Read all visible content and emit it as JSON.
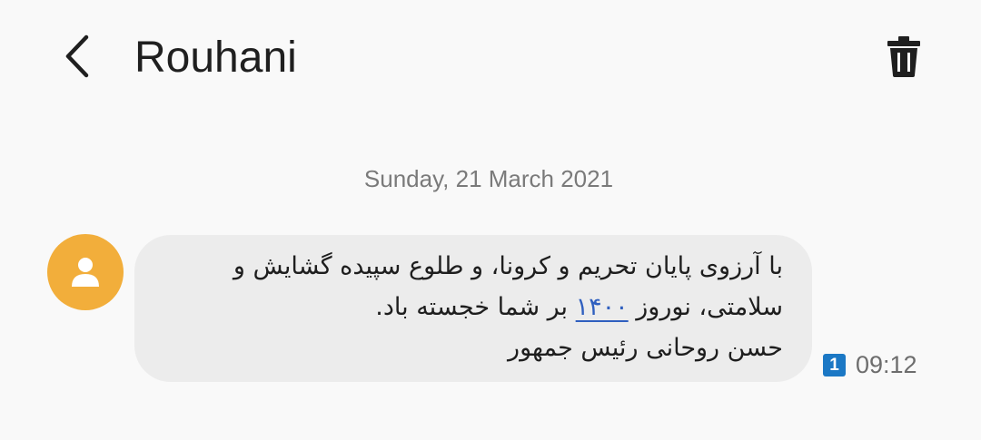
{
  "header": {
    "title": "Rouhani",
    "back_icon": "chevron-left-icon",
    "delete_icon": "trash-icon"
  },
  "conversation": {
    "date_separator": "Sunday, 21 March 2021",
    "messages": [
      {
        "avatar_icon": "person-icon",
        "avatar_color": "#f2ae3b",
        "lines": {
          "line1": "با آرزوی پایان تحریم و کرونا، و طلوع سپیده گشایش و",
          "line2_before": "سلامتی، نوروز",
          "line2_link": "۱۴۰۰",
          "line2_after": "بر شما خجسته باد.",
          "line3": "حسن روحانی رئیس جمهور"
        },
        "sim_badge": "1",
        "time": "09:12"
      }
    ]
  },
  "colors": {
    "background": "#f9f9f9",
    "bubble": "#ececec",
    "link": "#2f5fbf",
    "sim_badge": "#1b78c5"
  }
}
